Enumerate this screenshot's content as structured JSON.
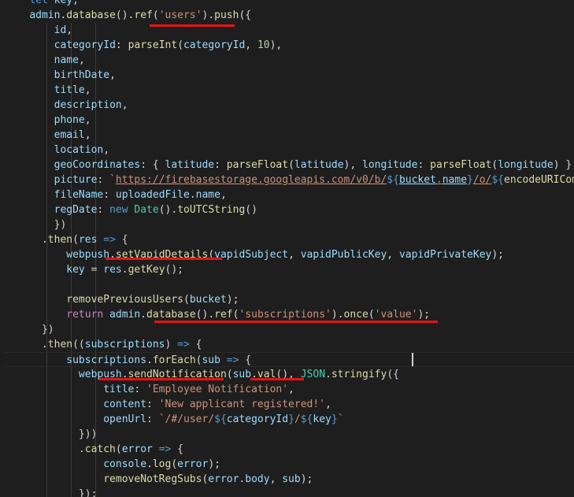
{
  "editor": {
    "colors": {
      "background": "#1e1e1e",
      "text": "#d4d4d4",
      "variable": "#9cdcfe",
      "function": "#dcdcaa",
      "string": "#ce9178",
      "number": "#b5cea8",
      "keyword": "#569cd6",
      "control": "#c586c0",
      "type": "#4ec9b0",
      "annotation_underline": "#e51414"
    },
    "current_line": 24,
    "lines": [
      [
        [
          "plain",
          "    "
        ],
        [
          "kw",
          "let"
        ],
        [
          "plain",
          " "
        ],
        [
          "var",
          "key"
        ],
        [
          "plain",
          ";"
        ]
      ],
      [
        [
          "plain",
          "    "
        ],
        [
          "var",
          "admin"
        ],
        [
          "plain",
          "."
        ],
        [
          "fn",
          "database"
        ],
        [
          "plain",
          "()."
        ],
        [
          "fn",
          "ref"
        ],
        [
          "plain",
          "("
        ],
        [
          "str",
          "'users'"
        ],
        [
          "plain",
          ")."
        ],
        [
          "fn",
          "push"
        ],
        [
          "plain",
          "({"
        ]
      ],
      [
        [
          "plain",
          "        "
        ],
        [
          "var",
          "id"
        ],
        [
          "plain",
          ","
        ]
      ],
      [
        [
          "plain",
          "        "
        ],
        [
          "var",
          "categoryId"
        ],
        [
          "plain",
          ": "
        ],
        [
          "fn",
          "parseInt"
        ],
        [
          "plain",
          "("
        ],
        [
          "var",
          "categoryId"
        ],
        [
          "plain",
          ", "
        ],
        [
          "num",
          "10"
        ],
        [
          "plain",
          "),"
        ]
      ],
      [
        [
          "plain",
          "        "
        ],
        [
          "var",
          "name"
        ],
        [
          "plain",
          ","
        ]
      ],
      [
        [
          "plain",
          "        "
        ],
        [
          "var",
          "birthDate"
        ],
        [
          "plain",
          ","
        ]
      ],
      [
        [
          "plain",
          "        "
        ],
        [
          "var",
          "title"
        ],
        [
          "plain",
          ","
        ]
      ],
      [
        [
          "plain",
          "        "
        ],
        [
          "var",
          "description"
        ],
        [
          "plain",
          ","
        ]
      ],
      [
        [
          "plain",
          "        "
        ],
        [
          "var",
          "phone"
        ],
        [
          "plain",
          ","
        ]
      ],
      [
        [
          "plain",
          "        "
        ],
        [
          "var",
          "email"
        ],
        [
          "plain",
          ","
        ]
      ],
      [
        [
          "plain",
          "        "
        ],
        [
          "var",
          "location"
        ],
        [
          "plain",
          ","
        ]
      ],
      [
        [
          "plain",
          "        "
        ],
        [
          "var",
          "geoCoordinates"
        ],
        [
          "plain",
          ": { "
        ],
        [
          "var",
          "latitude"
        ],
        [
          "plain",
          ": "
        ],
        [
          "fn",
          "parseFloat"
        ],
        [
          "plain",
          "("
        ],
        [
          "var",
          "latitude"
        ],
        [
          "plain",
          "), "
        ],
        [
          "var",
          "longitude"
        ],
        [
          "plain",
          ": "
        ],
        [
          "fn",
          "parseFloat"
        ],
        [
          "plain",
          "("
        ],
        [
          "var",
          "longitude"
        ],
        [
          "plain",
          ") },"
        ]
      ],
      [
        [
          "plain",
          "        "
        ],
        [
          "var",
          "picture"
        ],
        [
          "plain",
          ": "
        ],
        [
          "str",
          "`"
        ],
        [
          "link",
          "https://firebasestorage.googleapis.com/v0/b/"
        ],
        [
          "strpun",
          "${"
        ],
        [
          "linkvar",
          "bucket"
        ],
        [
          "link",
          "."
        ],
        [
          "linkvar",
          "name"
        ],
        [
          "strpun",
          "}"
        ],
        [
          "link",
          "/o/"
        ],
        [
          "strpun",
          "${"
        ],
        [
          "fn",
          "encodeURICom"
        ]
      ],
      [
        [
          "plain",
          "        "
        ],
        [
          "var",
          "fileName"
        ],
        [
          "plain",
          ": "
        ],
        [
          "var",
          "uploadedFile"
        ],
        [
          "plain",
          "."
        ],
        [
          "var",
          "name"
        ],
        [
          "plain",
          ","
        ]
      ],
      [
        [
          "plain",
          "        "
        ],
        [
          "var",
          "regDate"
        ],
        [
          "plain",
          ": "
        ],
        [
          "kw",
          "new"
        ],
        [
          "plain",
          " "
        ],
        [
          "type",
          "Date"
        ],
        [
          "plain",
          "()."
        ],
        [
          "fn",
          "toUTCString"
        ],
        [
          "plain",
          "()"
        ]
      ],
      [
        [
          "plain",
          "        })"
        ]
      ],
      [
        [
          "plain",
          "      ."
        ],
        [
          "fn",
          "then"
        ],
        [
          "plain",
          "("
        ],
        [
          "var",
          "res"
        ],
        [
          "plain",
          " "
        ],
        [
          "kw",
          "=>"
        ],
        [
          "plain",
          " {"
        ]
      ],
      [
        [
          "plain",
          "          "
        ],
        [
          "var",
          "webpush"
        ],
        [
          "plain",
          "."
        ],
        [
          "fn",
          "setVapidDetails"
        ],
        [
          "plain",
          "("
        ],
        [
          "var",
          "vapidSubject"
        ],
        [
          "plain",
          ", "
        ],
        [
          "var",
          "vapidPublicKey"
        ],
        [
          "plain",
          ", "
        ],
        [
          "var",
          "vapidPrivateKey"
        ],
        [
          "plain",
          ");"
        ]
      ],
      [
        [
          "plain",
          "          "
        ],
        [
          "var",
          "key"
        ],
        [
          "plain",
          " = "
        ],
        [
          "var",
          "res"
        ],
        [
          "plain",
          "."
        ],
        [
          "fn",
          "getKey"
        ],
        [
          "plain",
          "();"
        ]
      ],
      [
        [
          "plain",
          ""
        ]
      ],
      [
        [
          "plain",
          "          "
        ],
        [
          "fn",
          "removePreviousUsers"
        ],
        [
          "plain",
          "("
        ],
        [
          "var",
          "bucket"
        ],
        [
          "plain",
          ");"
        ]
      ],
      [
        [
          "plain",
          "          "
        ],
        [
          "ctrl",
          "return"
        ],
        [
          "plain",
          " "
        ],
        [
          "var",
          "admin"
        ],
        [
          "plain",
          "."
        ],
        [
          "fn",
          "database"
        ],
        [
          "plain",
          "()."
        ],
        [
          "fn",
          "ref"
        ],
        [
          "plain",
          "("
        ],
        [
          "str",
          "'subscriptions'"
        ],
        [
          "plain",
          ")."
        ],
        [
          "fn",
          "once"
        ],
        [
          "plain",
          "("
        ],
        [
          "str",
          "'value'"
        ],
        [
          "plain",
          ");"
        ]
      ],
      [
        [
          "plain",
          "      })"
        ]
      ],
      [
        [
          "plain",
          "      ."
        ],
        [
          "fn",
          "then"
        ],
        [
          "plain",
          "(("
        ],
        [
          "var",
          "subscriptions"
        ],
        [
          "plain",
          ") "
        ],
        [
          "kw",
          "=>"
        ],
        [
          "plain",
          " {"
        ]
      ],
      [
        [
          "plain",
          "          "
        ],
        [
          "var",
          "subscriptions"
        ],
        [
          "plain",
          "."
        ],
        [
          "fn",
          "forEach"
        ],
        [
          "plain",
          "("
        ],
        [
          "var",
          "sub"
        ],
        [
          "plain",
          " "
        ],
        [
          "kw",
          "=>"
        ],
        [
          "plain",
          " {"
        ]
      ],
      [
        [
          "plain",
          "            "
        ],
        [
          "var",
          "webpush"
        ],
        [
          "plain",
          "."
        ],
        [
          "fn",
          "sendNotification"
        ],
        [
          "plain",
          "("
        ],
        [
          "var",
          "sub"
        ],
        [
          "plain",
          "."
        ],
        [
          "fn",
          "val"
        ],
        [
          "plain",
          "(), "
        ],
        [
          "type",
          "JSON"
        ],
        [
          "plain",
          "."
        ],
        [
          "fn",
          "stringify"
        ],
        [
          "plain",
          "({"
        ]
      ],
      [
        [
          "plain",
          "                "
        ],
        [
          "var",
          "title"
        ],
        [
          "plain",
          ": "
        ],
        [
          "str",
          "'Employee Notification'"
        ],
        [
          "plain",
          ","
        ]
      ],
      [
        [
          "plain",
          "                "
        ],
        [
          "var",
          "content"
        ],
        [
          "plain",
          ": "
        ],
        [
          "str",
          "'New applicant registered!'"
        ],
        [
          "plain",
          ","
        ]
      ],
      [
        [
          "plain",
          "                "
        ],
        [
          "var",
          "openUrl"
        ],
        [
          "plain",
          ": "
        ],
        [
          "str",
          "`/#/user/"
        ],
        [
          "strpun",
          "${"
        ],
        [
          "var",
          "categoryId"
        ],
        [
          "strpun",
          "}"
        ],
        [
          "str",
          "/"
        ],
        [
          "strpun",
          "${"
        ],
        [
          "var",
          "key"
        ],
        [
          "strpun",
          "}"
        ],
        [
          "str",
          "`"
        ]
      ],
      [
        [
          "plain",
          "            }))"
        ]
      ],
      [
        [
          "plain",
          "            ."
        ],
        [
          "fn",
          "catch"
        ],
        [
          "plain",
          "("
        ],
        [
          "var",
          "error"
        ],
        [
          "plain",
          " "
        ],
        [
          "kw",
          "=>"
        ],
        [
          "plain",
          " {"
        ]
      ],
      [
        [
          "plain",
          "                "
        ],
        [
          "var",
          "console"
        ],
        [
          "plain",
          "."
        ],
        [
          "fn",
          "log"
        ],
        [
          "plain",
          "("
        ],
        [
          "var",
          "error"
        ],
        [
          "plain",
          ");"
        ]
      ],
      [
        [
          "plain",
          "                "
        ],
        [
          "fn",
          "removeNotRegSubs"
        ],
        [
          "plain",
          "("
        ],
        [
          "var",
          "error"
        ],
        [
          "plain",
          "."
        ],
        [
          "var",
          "body"
        ],
        [
          "plain",
          ", "
        ],
        [
          "var",
          "sub"
        ],
        [
          "plain",
          ");"
        ]
      ],
      [
        [
          "plain",
          "            });"
        ]
      ]
    ]
  }
}
